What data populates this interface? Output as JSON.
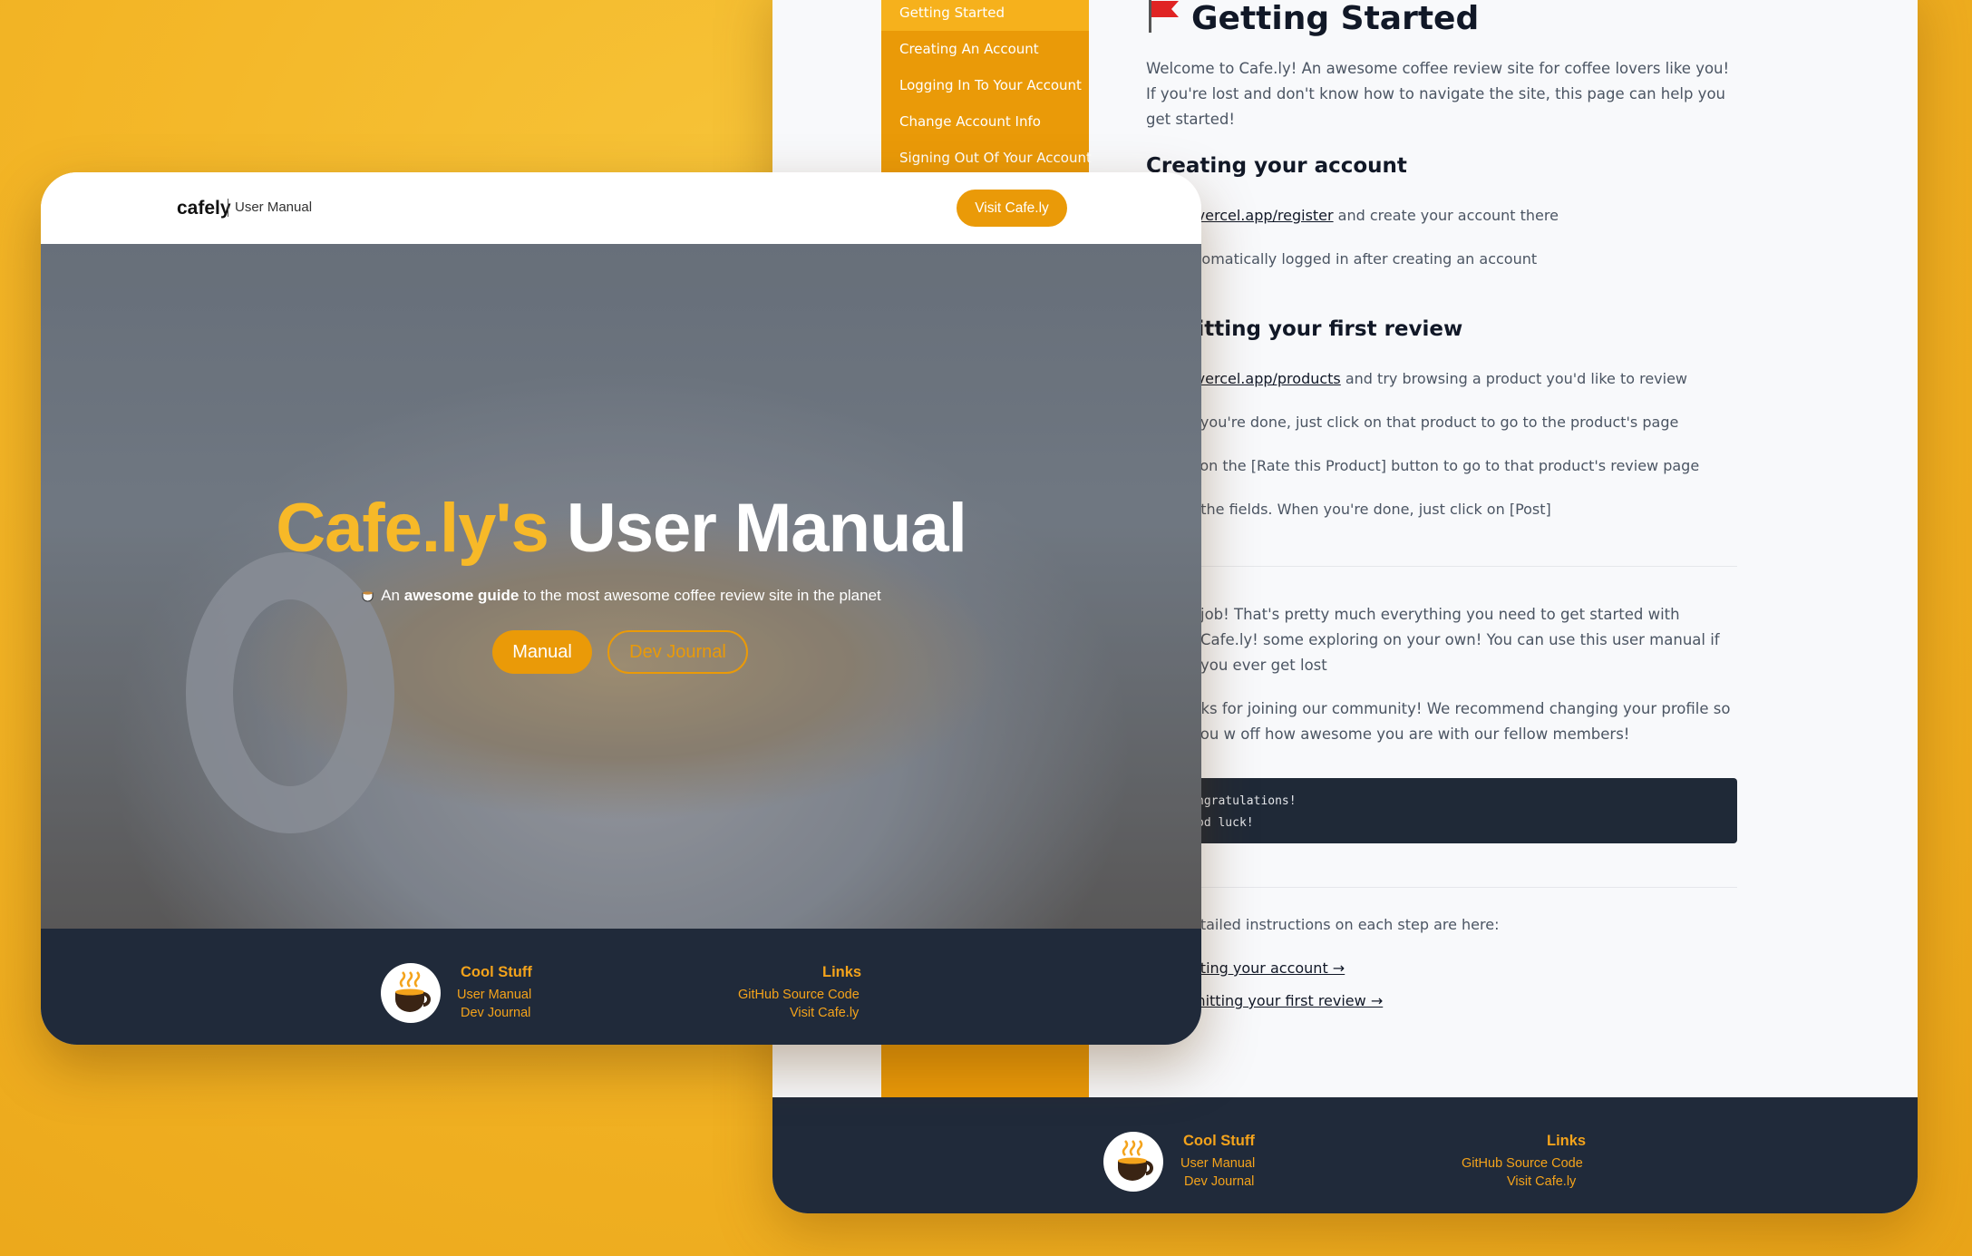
{
  "back": {
    "sidebar": {
      "items": [
        {
          "label": "Getting Started",
          "active": true
        },
        {
          "label": "Creating An Account"
        },
        {
          "label": "Logging In To Your Account"
        },
        {
          "label": "Change Account Info"
        },
        {
          "label": "Signing Out Of Your Account"
        }
      ]
    },
    "doc": {
      "title": "Getting Started",
      "intro": "Welcome to Cafe.ly! An awesome coffee review site for coffee lovers like you! If you're lost and don't know how to navigate the site, this page can help you get started!",
      "section1_title": "Creating your account",
      "s1_line1_prefix": "o ",
      "s1_line1_link": "cafely.vercel.app/register",
      "s1_line1_suffix": " and create your account there",
      "s1_line2": "utomatically logged in after creating an account",
      "section2_title": "nitting your first review",
      "s2_line1_prefix": "o ",
      "s2_line1_link": "cafely.vercel.app/products",
      "s2_line1_suffix": " and try browsing a product you'd like to review",
      "s2_line2": "e you're done, just click on that product to go to the product's page",
      "s2_line3": "k on the [Rate this Product] button to go to that product's review page",
      "s2_line4": "n the fields. When you're done, just click on [Post]",
      "para_a": "job! That's pretty much everything you need to get started with Cafe.ly! some exploring on your own! You can use this user manual if you ever get lost",
      "para_b": "nks for joining our community! We recommend changing your profile so you w off how awesome you are with our fellow members!",
      "code_line1": "ngratulations!",
      "code_line2": "od luck!",
      "detail_intro": "etailed instructions on each step are here:",
      "link_creating": "ating your account →",
      "link_submitting": "mitting your first review →"
    },
    "footer": {
      "col1_title": "Cool Stuff",
      "col1_links": [
        "User Manual",
        "Dev Journal"
      ],
      "col2_title": "Links",
      "col2_links": [
        "GitHub Source Code",
        "Visit Cafe.ly"
      ]
    }
  },
  "front": {
    "header": {
      "brand": "cafely",
      "brand_sub": "User Manual",
      "visit_button": "Visit Cafe.ly"
    },
    "hero": {
      "title_highlight": "Cafe.ly's",
      "title_rest": "User Manual",
      "subtitle_prefix": "An",
      "subtitle_bold": "awesome guide",
      "subtitle_suffix": "to the most awesome coffee review site in the planet",
      "manual_button": "Manual",
      "dev_button": "Dev Journal"
    },
    "footer": {
      "col1_title": "Cool Stuff",
      "col1_links": [
        "User Manual",
        "Dev Journal"
      ],
      "col2_title": "Links",
      "col2_links": [
        "GitHub Source Code",
        "Visit Cafe.ly"
      ]
    }
  },
  "colors": {
    "accent": "#ea9a08",
    "accent_light": "#f6b11c",
    "footer_bg": "#202a3a",
    "title_yellow": "#f7b928"
  }
}
